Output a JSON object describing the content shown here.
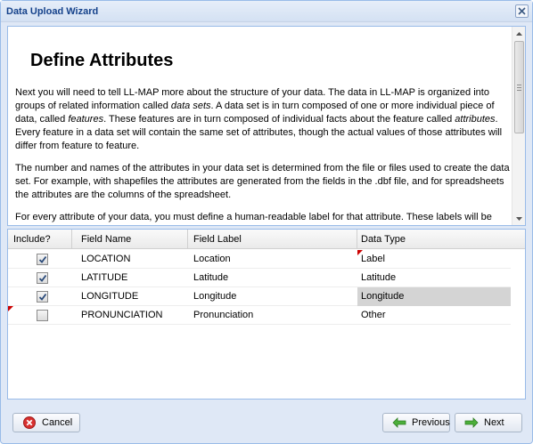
{
  "window": {
    "title": "Data Upload Wizard"
  },
  "content": {
    "heading": "Define Attributes",
    "paragraph1": {
      "t1": "Next you will need to tell LL-MAP more about the structure of your data. The data in LL-MAP is organized into groups of related information called ",
      "e1": "data sets",
      "t2": ". A data set is in turn composed of one or more individual piece of data, called ",
      "e2": "features",
      "t3": ". These features are in turn composed of individual facts about the feature called ",
      "e3": "attributes",
      "t4": ". Every feature in a data set will contain the same set of attributes, though the actual values of those attributes will differ from feature to feature."
    },
    "paragraph2": "The number and names of the attributes in your data set is determined from the file or files used to create the data set. For example, with shapefiles the attributes are generated from the fields in the .dbf file, and for spreadsheets the attributes are the columns of the spreadsheet.",
    "paragraph3": "For every attribute of your data, you must define a human-readable label for that attribute. These labels will be used to label default feature tooltips, ..."
  },
  "grid": {
    "columns": [
      "Include?",
      "Field Name",
      "Field Label",
      "Data Type"
    ],
    "rows": [
      {
        "include": true,
        "field_name": "LOCATION",
        "field_label": "Location",
        "data_type": "Label"
      },
      {
        "include": true,
        "field_name": "LATITUDE",
        "field_label": "Latitude",
        "data_type": "Latitude"
      },
      {
        "include": true,
        "field_name": "LONGITUDE",
        "field_label": "Longitude",
        "data_type": "Longitude"
      },
      {
        "include": false,
        "field_name": "PRONUNCIATION",
        "field_label": "Pronunciation",
        "data_type": "Other"
      }
    ]
  },
  "buttons": {
    "cancel": "Cancel",
    "previous": "Previous",
    "next": "Next"
  },
  "colors": {
    "title": "#15428b",
    "window_bg": "#dfe8f6",
    "border": "#99bbe8",
    "dirty_marker": "#cc0000",
    "selected_cell": "#d4d4d4"
  }
}
